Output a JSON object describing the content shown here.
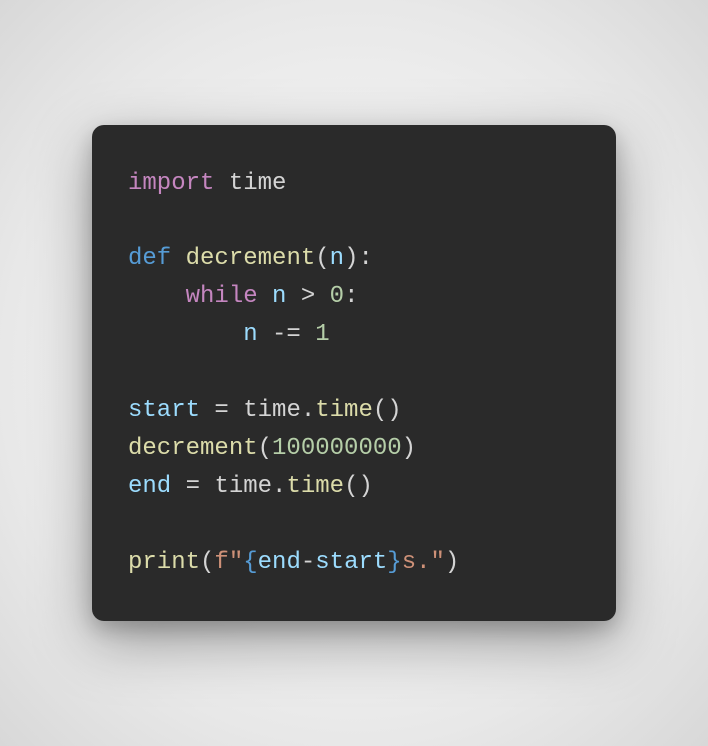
{
  "code": {
    "line1": {
      "import_kw": "import",
      "module": "time"
    },
    "line3": {
      "def_kw": "def",
      "func_name": "decrement",
      "lparen": "(",
      "param": "n",
      "rparen_colon": "):"
    },
    "line4": {
      "indent": "    ",
      "while_kw": "while",
      "var": "n",
      "gt": ">",
      "zero": "0",
      "colon": ":"
    },
    "line5": {
      "indent": "        ",
      "var": "n",
      "op": "-=",
      "one": "1"
    },
    "line7": {
      "var": "start",
      "eq": "=",
      "obj": "time",
      "dot": ".",
      "method": "time",
      "parens": "()"
    },
    "line8": {
      "func": "decrement",
      "lparen": "(",
      "arg": "100000000",
      "rparen": ")"
    },
    "line9": {
      "var": "end",
      "eq": "=",
      "obj": "time",
      "dot": ".",
      "method": "time",
      "parens": "()"
    },
    "line11": {
      "func": "print",
      "lparen": "(",
      "fprefix": "f\"",
      "lbrace": "{",
      "expr_a": "end",
      "minus": "-",
      "expr_b": "start",
      "rbrace": "}",
      "suffix": "s.\"",
      "rparen": ")"
    }
  }
}
